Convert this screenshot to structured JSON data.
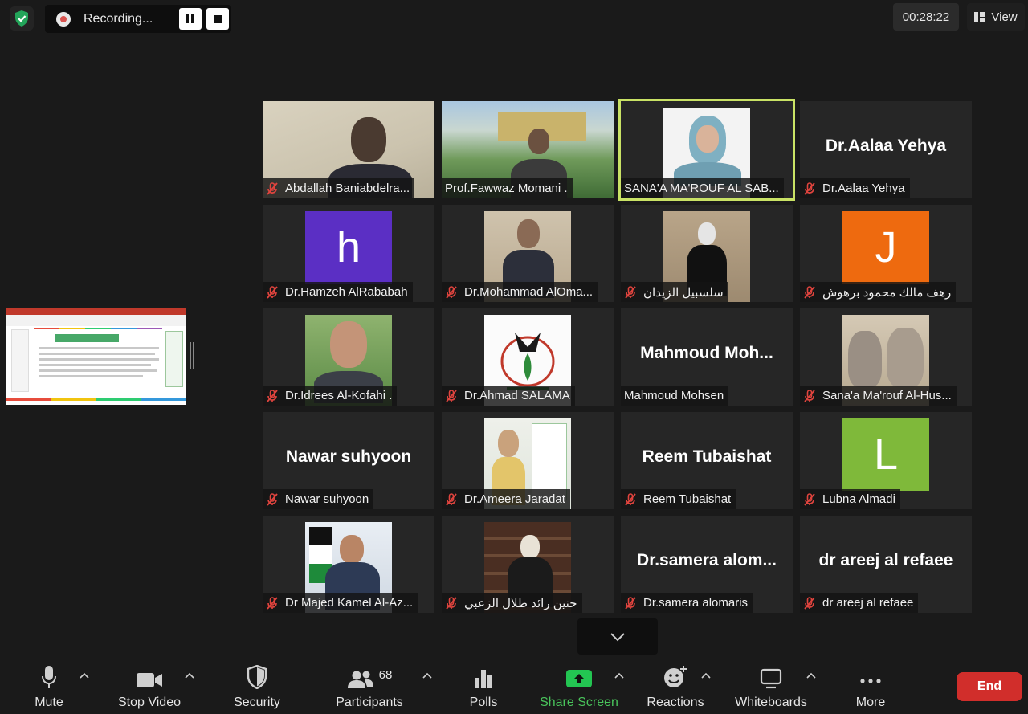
{
  "topbar": {
    "recording_label": "Recording...",
    "timer": "00:28:22",
    "view_label": "View"
  },
  "participants": [
    {
      "name": "Abdallah Baniabdelra...",
      "kind": "video"
    },
    {
      "name": "Prof.Fawwaz Momani .",
      "kind": "video"
    },
    {
      "name": "SANA'A MA'ROUF AL SAB...",
      "kind": "video",
      "active": true
    },
    {
      "name": "Dr.Aalaa Yehya",
      "kind": "text",
      "display": "Dr.Aalaa Yehya"
    },
    {
      "name": "Dr.Hamzeh AlRababah",
      "kind": "letter",
      "letter": "h",
      "color": "#5b2fc4"
    },
    {
      "name": "Dr.Mohammad AlOma...",
      "kind": "video"
    },
    {
      "name": "سلسبيل  الزيدان",
      "kind": "video"
    },
    {
      "name": "رهف مالك محمود برهوش",
      "kind": "letter",
      "letter": "J",
      "color": "#ee6a0f"
    },
    {
      "name": "Dr.Idrees Al-Kofahi .",
      "kind": "video"
    },
    {
      "name": "Dr.Ahmad SALAMA",
      "kind": "logo"
    },
    {
      "name": "Mahmoud Mohsen",
      "kind": "text",
      "display": "Mahmoud  Moh...",
      "no_mic": true
    },
    {
      "name": "Sana'a Ma'rouf Al-Hus...",
      "kind": "video"
    },
    {
      "name": "Nawar suhyoon",
      "kind": "text",
      "display": "Nawar suhyoon"
    },
    {
      "name": "Dr.Ameera Jaradat",
      "kind": "video"
    },
    {
      "name": "Reem Tubaishat",
      "kind": "text",
      "display": "Reem Tubaishat"
    },
    {
      "name": "Lubna Almadi",
      "kind": "letter",
      "letter": "L",
      "color": "#7fb93a"
    },
    {
      "name": "Dr Majed Kamel Al-Az...",
      "kind": "video"
    },
    {
      "name": "حنين رائد طلال الزعبي",
      "kind": "video"
    },
    {
      "name": "Dr.samera alomaris",
      "kind": "text",
      "display": "Dr.samera  alom..."
    },
    {
      "name": "dr areej al refaee",
      "kind": "text",
      "display": "dr areej al refaee"
    }
  ],
  "toolbar": {
    "mute": "Mute",
    "stop_video": "Stop Video",
    "security": "Security",
    "participants": "Participants",
    "participants_count": "68",
    "polls": "Polls",
    "share_screen": "Share Screen",
    "reactions": "Reactions",
    "whiteboards": "Whiteboards",
    "more": "More",
    "end": "End"
  },
  "colors": {
    "background": "#1a1a1a",
    "tile": "#262626",
    "active_outline": "#c9e265",
    "end_button": "#d12e2b",
    "share_green": "#49c35b",
    "mic_off_red": "#e0443e"
  },
  "icons": [
    "shield-check-icon",
    "record-dot-icon",
    "pause-icon",
    "stop-icon",
    "view-grid-icon",
    "mic-off-icon",
    "chevron-down-icon",
    "microphone-icon",
    "video-camera-icon",
    "shield-icon",
    "people-icon",
    "bar-chart-icon",
    "share-arrow-icon",
    "smiley-plus-icon",
    "whiteboard-icon",
    "ellipsis-icon"
  ]
}
